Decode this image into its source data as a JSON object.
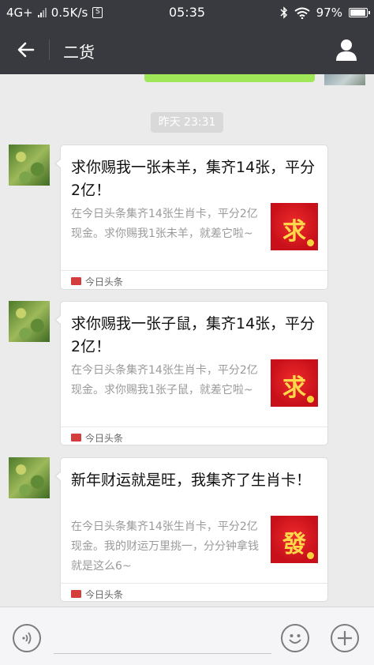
{
  "status_bar": {
    "network": "4G+",
    "speed": "0.5K/s",
    "sd_label": "S",
    "time": "05:35",
    "battery": "97%"
  },
  "header": {
    "title": "二货",
    "back_icon": "arrow-left-icon",
    "profile_icon": "person-icon"
  },
  "chat": {
    "timestamp": "昨天 23:31",
    "messages": [
      {
        "title": "求你赐我一张未羊，集齐14张，平分2亿！",
        "description": "在今日头条集齐14张生肖卡，平分2亿现金。求你赐我1张未羊，就差它啦~",
        "thumb_char": "求",
        "source": "今日头条"
      },
      {
        "title": "求你赐我一张子鼠，集齐14张，平分2亿！",
        "description": "在今日头条集齐14张生肖卡，平分2亿现金。求你赐我1张子鼠，就差它啦~",
        "thumb_char": "求",
        "source": "今日头条"
      },
      {
        "title": "新年财运就是旺，我集齐了生肖卡！",
        "description": "在今日头条集齐14张生肖卡，平分2亿现金。我的财运万里挑一，分分钟拿钱就是这么6~",
        "thumb_char": "發",
        "source": "今日头条"
      }
    ]
  },
  "bottom_bar": {
    "voice_icon": "voice-icon",
    "emoji_icon": "emoji-icon",
    "plus_icon": "plus-icon"
  }
}
